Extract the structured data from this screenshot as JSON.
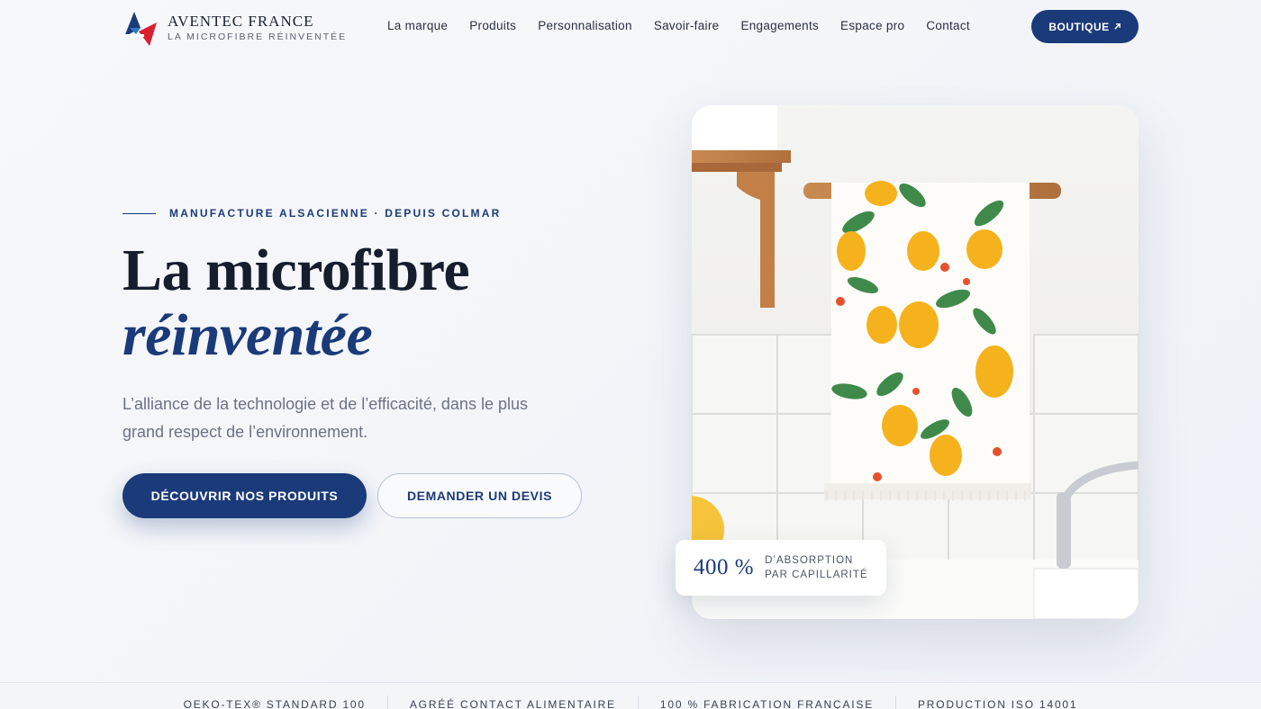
{
  "brand": {
    "name": "AVENTEC FRANCE",
    "tagline": "LA MICROFIBRE RÉINVENTÉE",
    "logo_mark_text": "AVENTEC FRANCE"
  },
  "nav": {
    "items": [
      {
        "label": "La marque"
      },
      {
        "label": "Produits"
      },
      {
        "label": "Personnalisation"
      },
      {
        "label": "Savoir-faire"
      },
      {
        "label": "Engagements"
      },
      {
        "label": "Espace pro"
      },
      {
        "label": "Contact"
      }
    ],
    "shop_label": "BOUTIQUE",
    "shop_icon": "arrow-up-right-icon"
  },
  "hero": {
    "eyebrow": "MANUFACTURE ALSACIENNE · DEPUIS COLMAR",
    "title_line1": "La microfibre",
    "title_line2": "réinventée",
    "lead": "L’alliance de la technologie et de l’efficacité, dans le plus grand respect de l’environnement.",
    "cta_primary": "DÉCOUVRIR NOS PRODUITS",
    "cta_secondary": "DEMANDER UN DEVIS"
  },
  "stat": {
    "value": "400 %",
    "label_line1": "D’ABSORPTION",
    "label_line2": "PAR CAPILLARITÉ"
  },
  "trust": {
    "items": [
      "OEKO-TEX® STANDARD 100",
      "AGRÉÉ CONTACT ALIMENTAIRE",
      "100 % FABRICATION FRANÇAISE",
      "PRODUCTION ISO 14001"
    ]
  },
  "colors": {
    "brand_blue": "#1a3a7a",
    "brand_red": "#d9202e",
    "background": "#f5f6fa"
  }
}
